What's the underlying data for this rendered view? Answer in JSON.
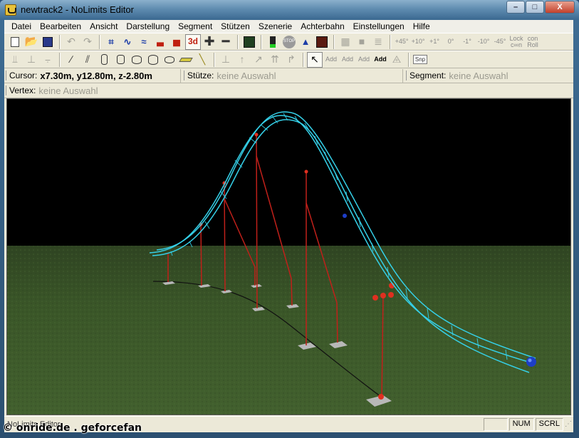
{
  "window": {
    "title": "newtrack2 - NoLimits Editor",
    "icon": "rollercoaster-app-icon",
    "controls": {
      "minimize": "–",
      "maximize": "□",
      "close": "X"
    }
  },
  "menu": [
    "Datei",
    "Bearbeiten",
    "Ansicht",
    "Darstellung",
    "Segment",
    "Stützen",
    "Szenerie",
    "Achterbahn",
    "Einstellungen",
    "Hilfe"
  ],
  "toolbar1": {
    "degree_buttons": [
      "+45°",
      "+10°",
      "+1°",
      "0°",
      "-1°",
      "-10°",
      "-45°"
    ],
    "lock_label": "Lock\nc∞n",
    "roll_label": "con\nRoll",
    "threed_label": "3d",
    "stop_label": "STOP"
  },
  "toolbar2": {
    "add_labels": [
      "Add",
      "Add",
      "Add",
      "Add"
    ],
    "snap_label": "Snp"
  },
  "info": {
    "cursor_label": "Cursor:",
    "cursor_value": "x7.30m, y12.80m, z-2.80m",
    "support_label": "Stütze:",
    "support_value": "keine Auswahl",
    "segment_label": "Segment:",
    "segment_value": "keine Auswahl",
    "vertex_label": "Vertex:",
    "vertex_value": "keine Auswahl"
  },
  "status": {
    "main": "NoLimits Editor",
    "num": "NUM",
    "scrl": "SCRL"
  },
  "watermark": "© onride.de . geforcefan",
  "colors": {
    "sky": "#000000",
    "grass": "#3f5a2a",
    "track": "#35d0e8",
    "support": "#c0201a"
  }
}
